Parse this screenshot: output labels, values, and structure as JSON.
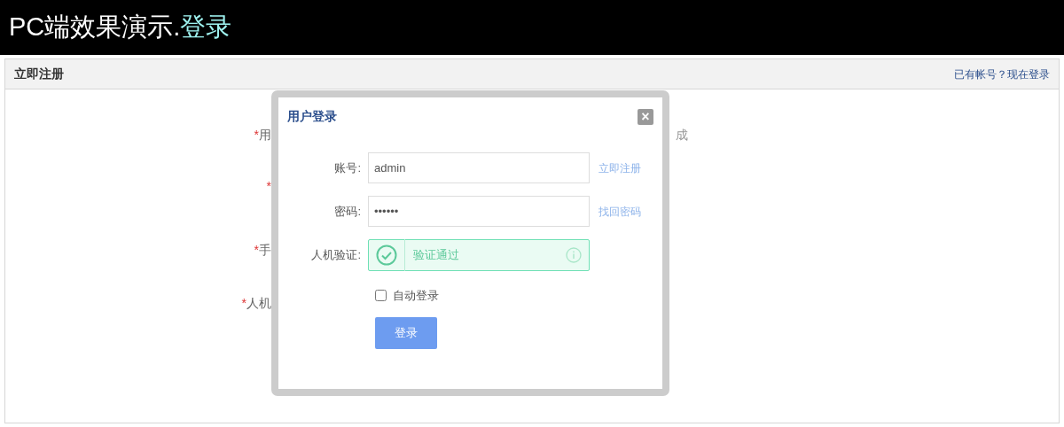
{
  "header": {
    "title": "PC端效果演示.",
    "title_highlight": "登录"
  },
  "panel": {
    "title": "立即注册",
    "link": "已有帐号？现在登录"
  },
  "background_form": {
    "rows": [
      {
        "mark": "*",
        "label": "用",
        "hint": "成"
      },
      {
        "mark": "*"
      },
      {
        "mark": "*",
        "label": "手"
      },
      {
        "mark": "*",
        "label": "人机"
      }
    ]
  },
  "dialog": {
    "title": "用户登录",
    "close": "×",
    "fields": [
      {
        "kind": "input",
        "label": "账号:",
        "value": "admin",
        "link": "立即注册"
      },
      {
        "kind": "input",
        "label": "密码:",
        "value": "••••••",
        "link": "找回密码"
      },
      {
        "kind": "captcha",
        "label": "人机验证:",
        "value": "验证通过",
        "verified": true
      }
    ],
    "remember": {
      "label": "自动登录",
      "checked": false
    },
    "submit": "登录"
  }
}
